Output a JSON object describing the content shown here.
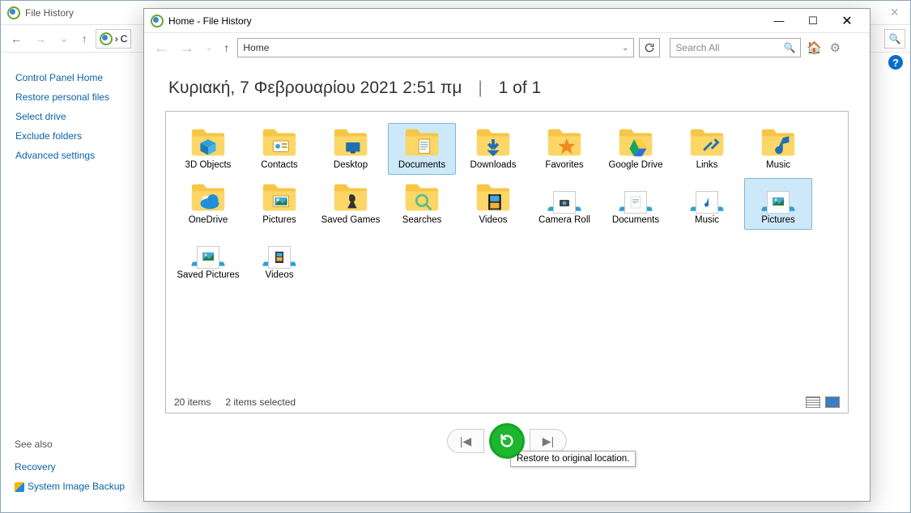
{
  "outer": {
    "title": "File History",
    "sidebar": {
      "heading": "Control Panel Home",
      "links": [
        "Restore personal files",
        "Select drive",
        "Exclude folders",
        "Advanced settings"
      ],
      "see_also_heading": "See also",
      "see_also_links": [
        "Recovery",
        "System Image Backup"
      ]
    }
  },
  "inner": {
    "title": "Home - File History",
    "address": "Home",
    "search_placeholder": "Search All",
    "banner_date": "Κυριακή, 7 Φεβρουαρίου 2021 2:51 πμ",
    "banner_page": "1 of 1",
    "status_count": "20 items",
    "status_sel": "2 items selected",
    "tooltip": "Restore to original location.",
    "items": [
      {
        "name": "3D Objects",
        "kind": "folder",
        "overlay": "cube",
        "sel": false
      },
      {
        "name": "Contacts",
        "kind": "folder",
        "overlay": "contact",
        "sel": false
      },
      {
        "name": "Desktop",
        "kind": "folder",
        "overlay": "desktop",
        "sel": false
      },
      {
        "name": "Documents",
        "kind": "folder",
        "overlay": "doc",
        "sel": true
      },
      {
        "name": "Downloads",
        "kind": "folder",
        "overlay": "down",
        "sel": false
      },
      {
        "name": "Favorites",
        "kind": "folder",
        "overlay": "star",
        "sel": false
      },
      {
        "name": "Google Drive",
        "kind": "folder",
        "overlay": "gdrive",
        "sel": false
      },
      {
        "name": "Links",
        "kind": "folder",
        "overlay": "link",
        "sel": false
      },
      {
        "name": "Music",
        "kind": "folder",
        "overlay": "note",
        "sel": false
      },
      {
        "name": "OneDrive",
        "kind": "folder",
        "overlay": "cloud",
        "sel": false
      },
      {
        "name": "Pictures",
        "kind": "folder",
        "overlay": "pic",
        "sel": false
      },
      {
        "name": "Saved Games",
        "kind": "folder",
        "overlay": "chess",
        "sel": false
      },
      {
        "name": "Searches",
        "kind": "folder",
        "overlay": "search",
        "sel": false
      },
      {
        "name": "Videos",
        "kind": "folder",
        "overlay": "film",
        "sel": false
      },
      {
        "name": "Camera Roll",
        "kind": "library",
        "overlay": "cam",
        "sel": false
      },
      {
        "name": "Documents",
        "kind": "library",
        "overlay": "doc",
        "sel": false
      },
      {
        "name": "Music",
        "kind": "library",
        "overlay": "note",
        "sel": false
      },
      {
        "name": "Pictures",
        "kind": "library",
        "overlay": "pic",
        "sel": true
      },
      {
        "name": "Saved Pictures",
        "kind": "library",
        "overlay": "pic",
        "sel": false
      },
      {
        "name": "Videos",
        "kind": "library",
        "overlay": "film",
        "sel": false
      }
    ]
  }
}
